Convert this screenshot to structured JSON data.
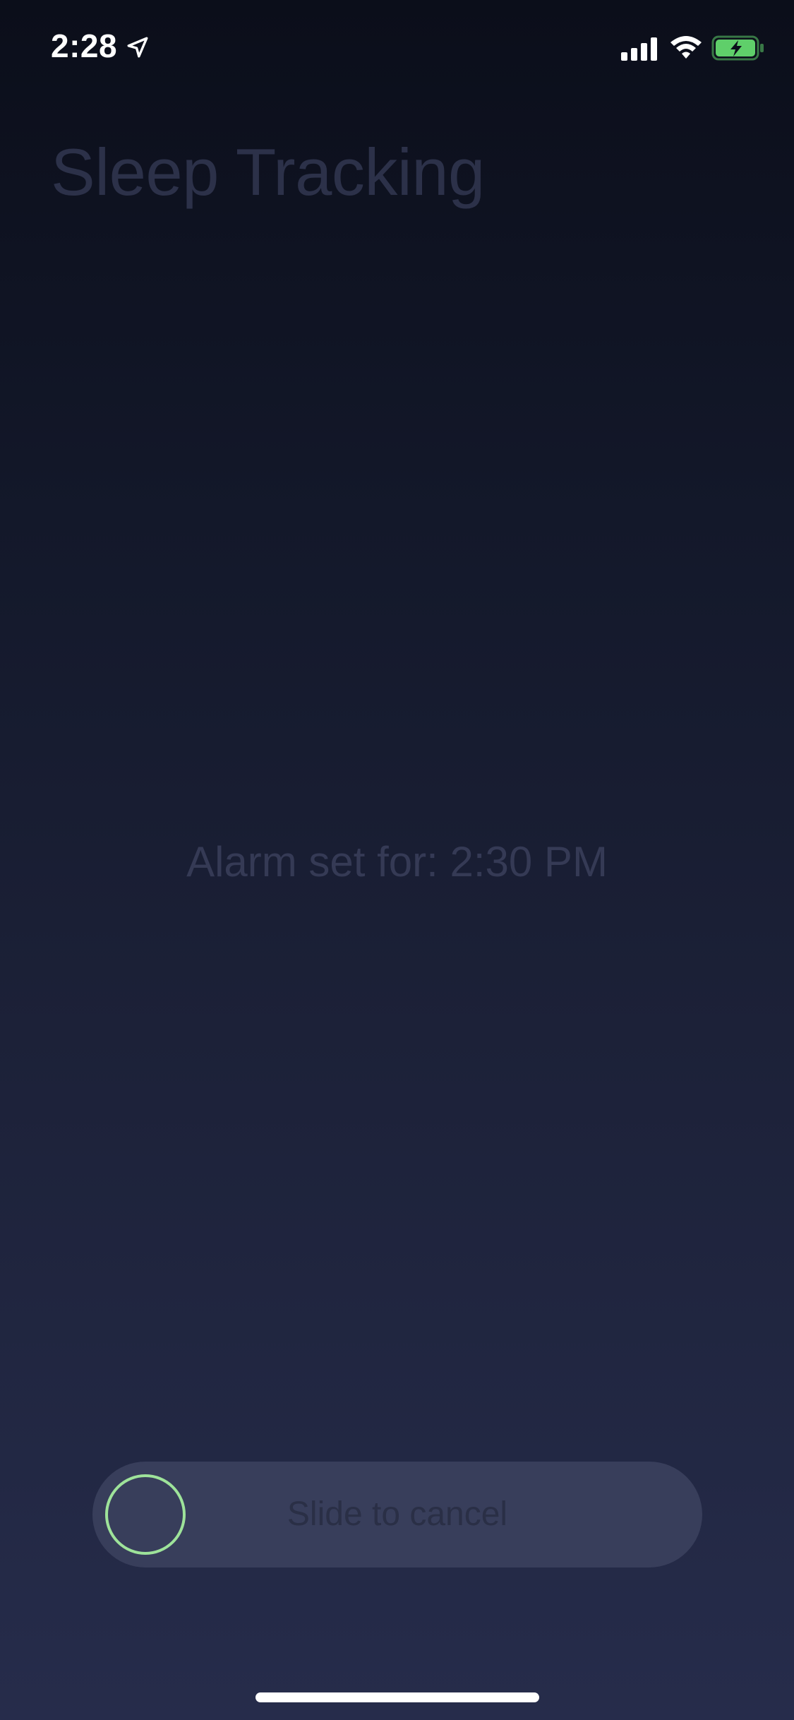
{
  "status_bar": {
    "time": "2:28",
    "location_icon": "location-arrow-icon",
    "signal_icon": "cellular-signal-icon",
    "wifi_icon": "wifi-icon",
    "battery_icon": "battery-charging-icon",
    "battery_color": "#5fcf6a"
  },
  "header": {
    "title": "Sleep Tracking"
  },
  "main": {
    "alarm_text": "Alarm set for: 2:30 PM"
  },
  "slider": {
    "label": "Slide to cancel",
    "knob_color": "#9ee39a",
    "progress": 0
  },
  "colors": {
    "background_top": "#0b0e1a",
    "background_bottom": "#262c4b",
    "track": "#383e5b"
  }
}
